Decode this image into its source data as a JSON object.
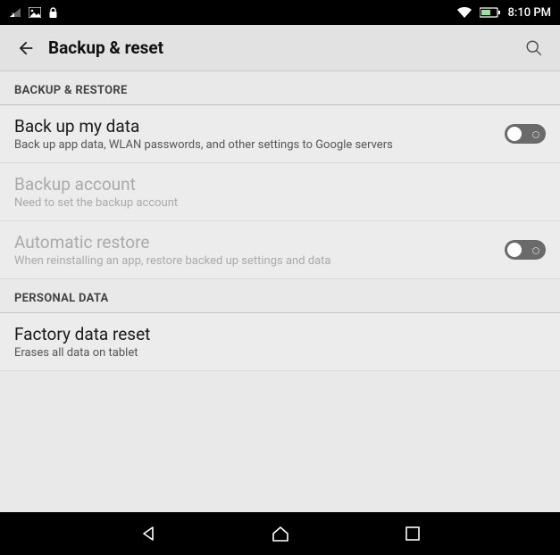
{
  "status": {
    "time": "8:10 PM"
  },
  "header": {
    "title": "Backup & reset"
  },
  "sections": {
    "backup_restore": {
      "header": "BACKUP & RESTORE",
      "backup_data": {
        "title": "Back up my data",
        "sub": "Back up app data, WLAN passwords, and other settings to Google servers"
      },
      "backup_account": {
        "title": "Backup account",
        "sub": "Need to set the backup account"
      },
      "auto_restore": {
        "title": "Automatic restore",
        "sub": "When reinstalling an app, restore backed up settings and data"
      }
    },
    "personal_data": {
      "header": "PERSONAL DATA",
      "factory_reset": {
        "title": "Factory data reset",
        "sub": "Erases all data on tablet"
      }
    }
  }
}
